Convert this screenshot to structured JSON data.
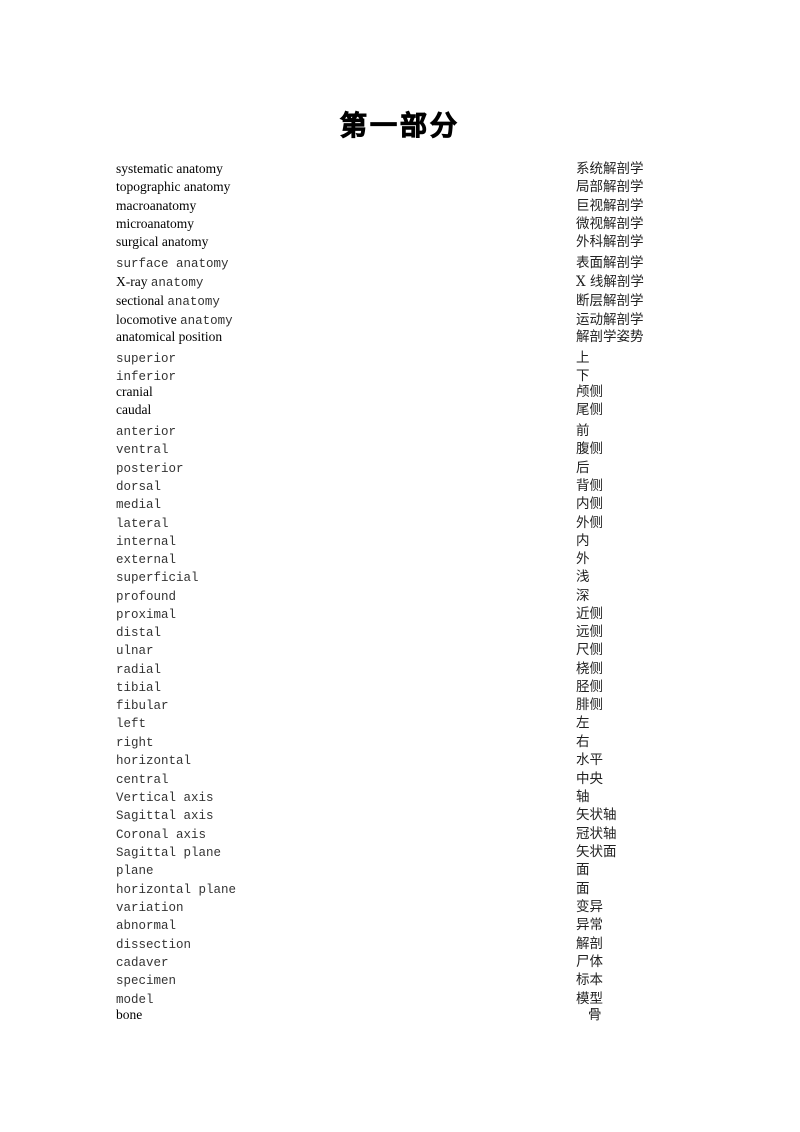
{
  "document": {
    "title": "第一部分",
    "entries": [
      {
        "en": [
          {
            "t": "systematic anatomy",
            "f": "serif"
          }
        ],
        "zh": "系统解剖学"
      },
      {
        "en": [
          {
            "t": "topographic anatomy",
            "f": "serif"
          }
        ],
        "zh": "局部解剖学"
      },
      {
        "en": [
          {
            "t": "macroanatomy",
            "f": "serif"
          }
        ],
        "zh": "巨视解剖学"
      },
      {
        "en": [
          {
            "t": "microanatomy",
            "f": "serif"
          }
        ],
        "zh": "微视解剖学"
      },
      {
        "en": [
          {
            "t": "surgical anatomy",
            "f": "serif"
          }
        ],
        "zh": "外科解剖学"
      },
      {
        "en": [
          {
            "t": "surface anatomy",
            "f": "mono"
          }
        ],
        "zh": "表面解剖学"
      },
      {
        "en": [
          {
            "t": "X-ray ",
            "f": "serif"
          },
          {
            "t": "anatomy",
            "f": "mono"
          }
        ],
        "zh": "X 线解剖学"
      },
      {
        "en": [
          {
            "t": "sectional ",
            "f": "serif"
          },
          {
            "t": "anatomy",
            "f": "mono"
          }
        ],
        "zh": "断层解剖学"
      },
      {
        "en": [
          {
            "t": "locomotive ",
            "f": "serif"
          },
          {
            "t": "anatomy",
            "f": "mono"
          }
        ],
        "zh": "运动解剖学"
      },
      {
        "en": [
          {
            "t": "anatomical position",
            "f": "serif"
          }
        ],
        "zh": "解剖学姿势"
      },
      {
        "en": [
          {
            "t": "superior",
            "f": "mono"
          }
        ],
        "zh": "上"
      },
      {
        "en": [
          {
            "t": "inferior",
            "f": "mono"
          }
        ],
        "zh": "下"
      },
      {
        "en": [
          {
            "t": "cranial",
            "f": "serif"
          }
        ],
        "zh": "颅侧"
      },
      {
        "en": [
          {
            "t": "caudal",
            "f": "serif"
          }
        ],
        "zh": "尾侧"
      },
      {
        "en": [
          {
            "t": "anterior",
            "f": "mono"
          }
        ],
        "zh": "前"
      },
      {
        "en": [
          {
            "t": "ventral",
            "f": "mono"
          }
        ],
        "zh": "腹侧"
      },
      {
        "en": [
          {
            "t": "posterior",
            "f": "mono"
          }
        ],
        "zh": "后"
      },
      {
        "en": [
          {
            "t": "dorsal",
            "f": "mono"
          }
        ],
        "zh": "背侧"
      },
      {
        "en": [
          {
            "t": "medial",
            "f": "mono"
          }
        ],
        "zh": "内侧"
      },
      {
        "en": [
          {
            "t": "lateral",
            "f": "mono"
          }
        ],
        "zh": "外侧"
      },
      {
        "en": [
          {
            "t": "internal",
            "f": "mono"
          }
        ],
        "zh": "内"
      },
      {
        "en": [
          {
            "t": "external",
            "f": "mono"
          }
        ],
        "zh": "外"
      },
      {
        "en": [
          {
            "t": "superficial",
            "f": "mono"
          }
        ],
        "zh": "浅"
      },
      {
        "en": [
          {
            "t": "profound",
            "f": "mono"
          }
        ],
        "zh": "深"
      },
      {
        "en": [
          {
            "t": "proximal",
            "f": "mono"
          }
        ],
        "zh": "近侧"
      },
      {
        "en": [
          {
            "t": "distal",
            "f": "mono"
          }
        ],
        "zh": "远侧"
      },
      {
        "en": [
          {
            "t": "ulnar",
            "f": "mono"
          }
        ],
        "zh": "尺侧"
      },
      {
        "en": [
          {
            "t": "radial",
            "f": "mono"
          }
        ],
        "zh": "桡侧"
      },
      {
        "en": [
          {
            "t": "tibial",
            "f": "mono"
          }
        ],
        "zh": "胫侧"
      },
      {
        "en": [
          {
            "t": "fibular",
            "f": "mono"
          }
        ],
        "zh": "腓侧"
      },
      {
        "en": [
          {
            "t": "left",
            "f": "mono"
          }
        ],
        "zh": "左"
      },
      {
        "en": [
          {
            "t": "right",
            "f": "mono"
          }
        ],
        "zh": "右"
      },
      {
        "en": [
          {
            "t": "horizontal",
            "f": "mono"
          }
        ],
        "zh": "水平"
      },
      {
        "en": [
          {
            "t": "central",
            "f": "mono"
          }
        ],
        "zh": "中央"
      },
      {
        "en": [
          {
            "t": "Vertical axis",
            "f": "mono"
          }
        ],
        "zh": "轴"
      },
      {
        "en": [
          {
            "t": "Sagittal axis",
            "f": "mono"
          }
        ],
        "zh": "矢状轴"
      },
      {
        "en": [
          {
            "t": "Coronal axis",
            "f": "mono"
          }
        ],
        "zh": "冠状轴"
      },
      {
        "en": [
          {
            "t": "Sagittal plane",
            "f": "mono"
          }
        ],
        "zh": "矢状面"
      },
      {
        "en": [
          {
            "t": "plane",
            "f": "mono"
          }
        ],
        "zh": "面"
      },
      {
        "en": [
          {
            "t": "horizontal plane",
            "f": "mono"
          }
        ],
        "zh": "面"
      },
      {
        "en": [
          {
            "t": "variation",
            "f": "mono"
          }
        ],
        "zh": "变异"
      },
      {
        "en": [
          {
            "t": "abnormal",
            "f": "mono"
          }
        ],
        "zh": "异常"
      },
      {
        "en": [
          {
            "t": "dissection",
            "f": "mono"
          }
        ],
        "zh": "解剖"
      },
      {
        "en": [
          {
            "t": "cadaver",
            "f": "mono"
          }
        ],
        "zh": "尸体"
      },
      {
        "en": [
          {
            "t": "specimen",
            "f": "mono"
          }
        ],
        "zh": "标本"
      },
      {
        "en": [
          {
            "t": "model",
            "f": "mono"
          }
        ],
        "zh": "模型"
      },
      {
        "en": [
          {
            "t": "bone",
            "f": "serif"
          }
        ],
        "zh": "骨",
        "zh_indent": true
      }
    ]
  }
}
